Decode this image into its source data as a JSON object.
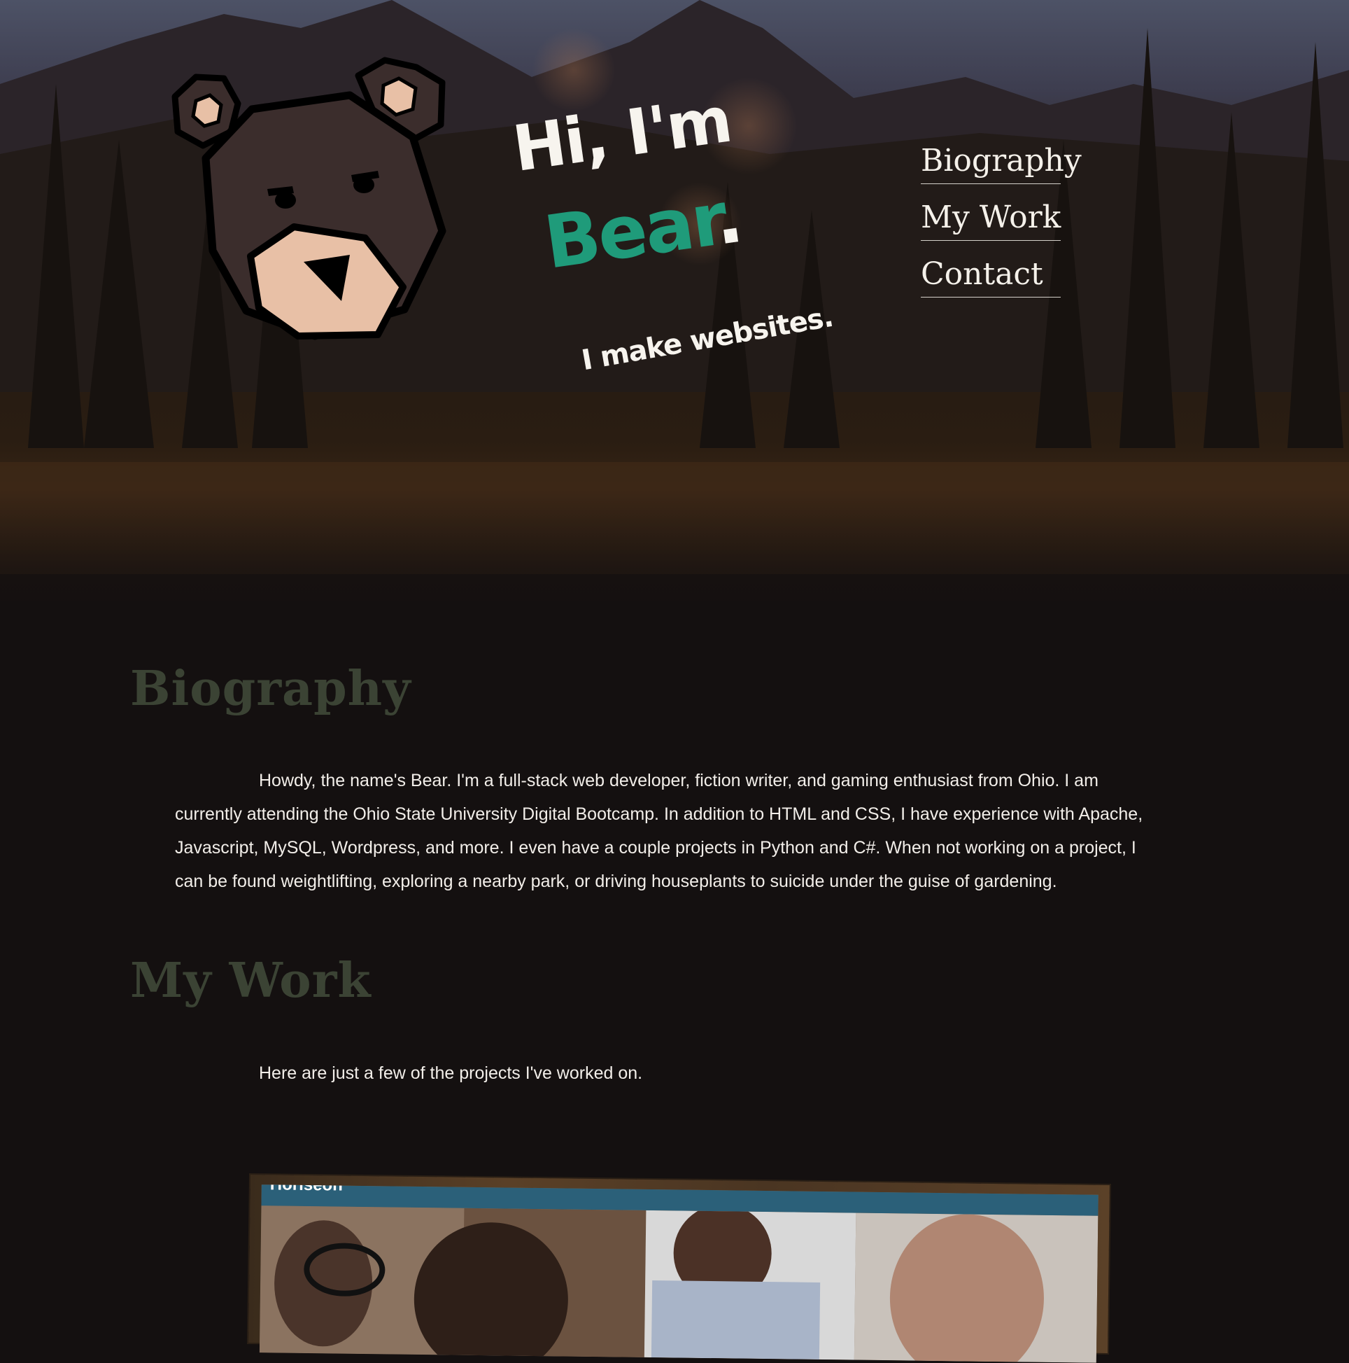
{
  "hero": {
    "greeting": "Hi, I'm",
    "name": "Bear",
    "name_punctuation": ".",
    "tagline": "I make websites.",
    "accent_color": "#1f9b7a",
    "logo_icon": "bear-head-icon"
  },
  "nav": {
    "items": [
      {
        "label": "Biography"
      },
      {
        "label": "My Work"
      },
      {
        "label": "Contact"
      }
    ]
  },
  "biography": {
    "title": "Biography",
    "text": "Howdy, the name's Bear. I'm a full-stack web developer, fiction writer, and gaming enthusiast from Ohio. I am currently attending the Ohio State University Digital Bootcamp. In addition to HTML and CSS, I have experience with Apache, Javascript, MySQL, Wordpress, and more. I even have a couple projects in Python and C#. When not working on a project, I can be found weightlifting, exploring a nearby park, or driving houseplants to suicide under the guise of gardening."
  },
  "work": {
    "title": "My Work",
    "intro": "Here are just a few of the projects I've worked on.",
    "projects": [
      {
        "brand": "Horiseon"
      }
    ]
  },
  "colors": {
    "background": "#141010",
    "section_title": "#3b4334",
    "text": "#f2eee9"
  }
}
